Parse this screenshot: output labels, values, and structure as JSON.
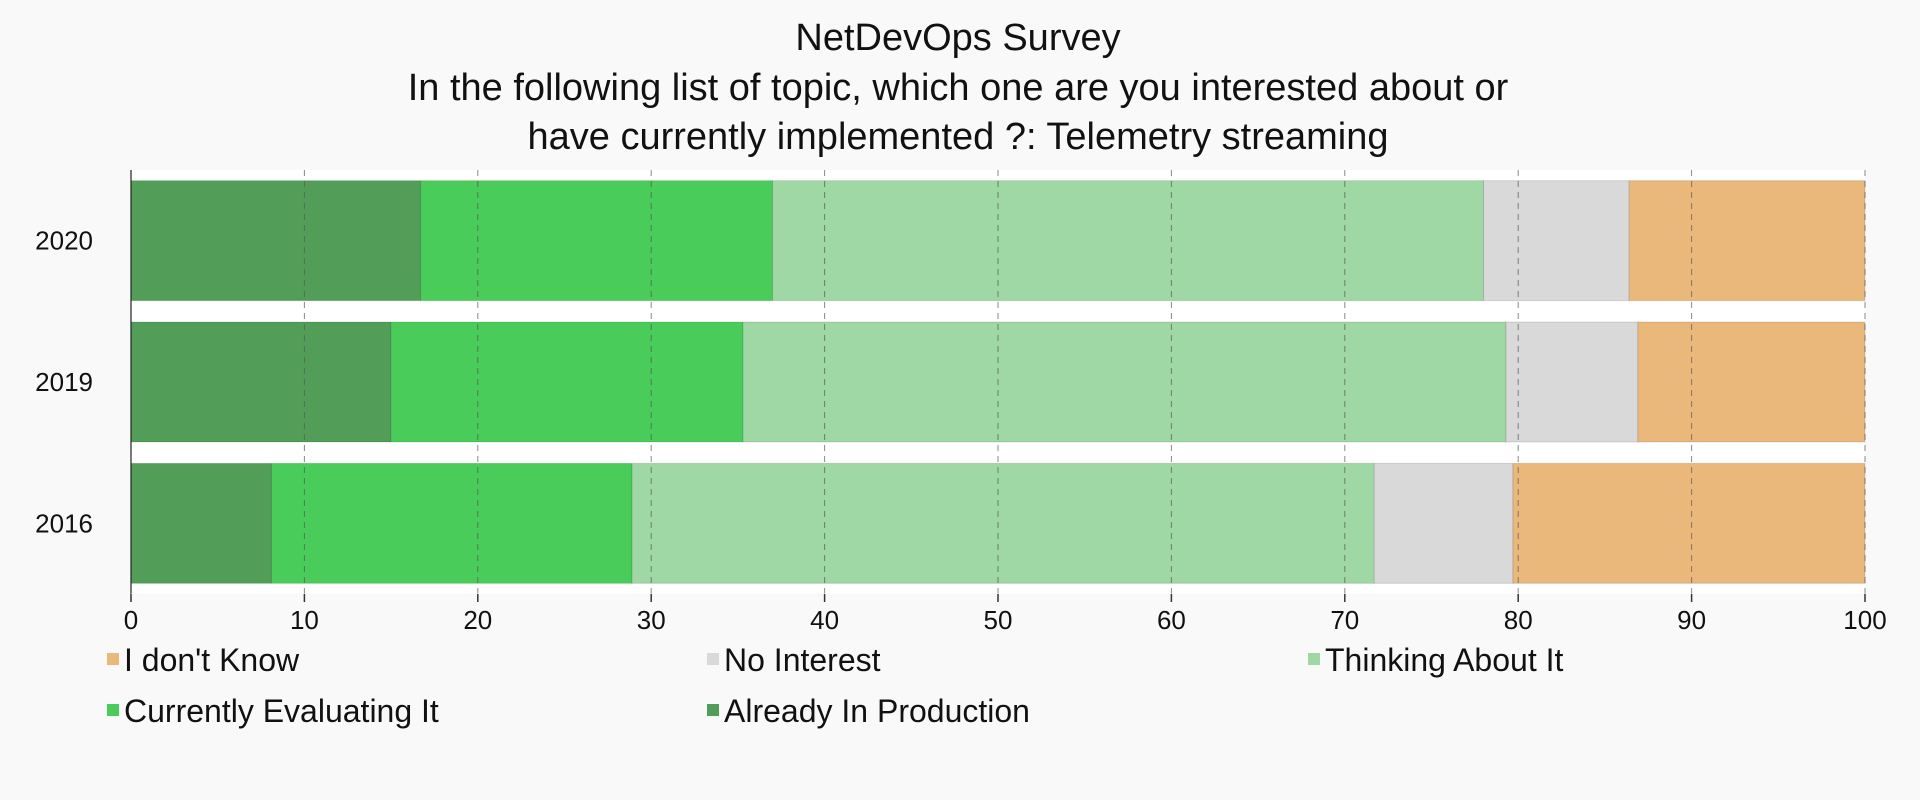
{
  "chart_data": {
    "type": "bar",
    "orientation": "horizontal",
    "stacked": true,
    "title": [
      "NetDevOps Survey",
      "In the following list of topic, which one are you interested about or",
      "have currently implemented ?: Telemetry streaming"
    ],
    "categories": [
      "2020",
      "2019",
      "2016"
    ],
    "series": [
      {
        "name": "Already In Production",
        "color": "#529e58",
        "values": [
          16.7,
          15.0,
          8.1
        ]
      },
      {
        "name": "Currently Evaluating It",
        "color": "#49cc5a",
        "values": [
          20.3,
          20.3,
          20.8
        ]
      },
      {
        "name": "Thinking About It",
        "color": "#a0d8a5",
        "values": [
          41.0,
          44.0,
          42.8
        ]
      },
      {
        "name": "No Interest",
        "color": "#d9d9d9",
        "values": [
          8.4,
          7.6,
          8.0
        ]
      },
      {
        "name": "I don't Know",
        "color": "#ebb87c",
        "values": [
          13.6,
          13.1,
          20.3
        ]
      }
    ],
    "legend_order": [
      "I don't Know",
      "No Interest",
      "Thinking About It",
      "Currently Evaluating It",
      "Already In Production"
    ],
    "xlim": [
      0,
      100
    ],
    "xticks": [
      0,
      10,
      20,
      30,
      40,
      50,
      60,
      70,
      80,
      90,
      100
    ],
    "grid": true,
    "legend_placement": "bottom"
  }
}
